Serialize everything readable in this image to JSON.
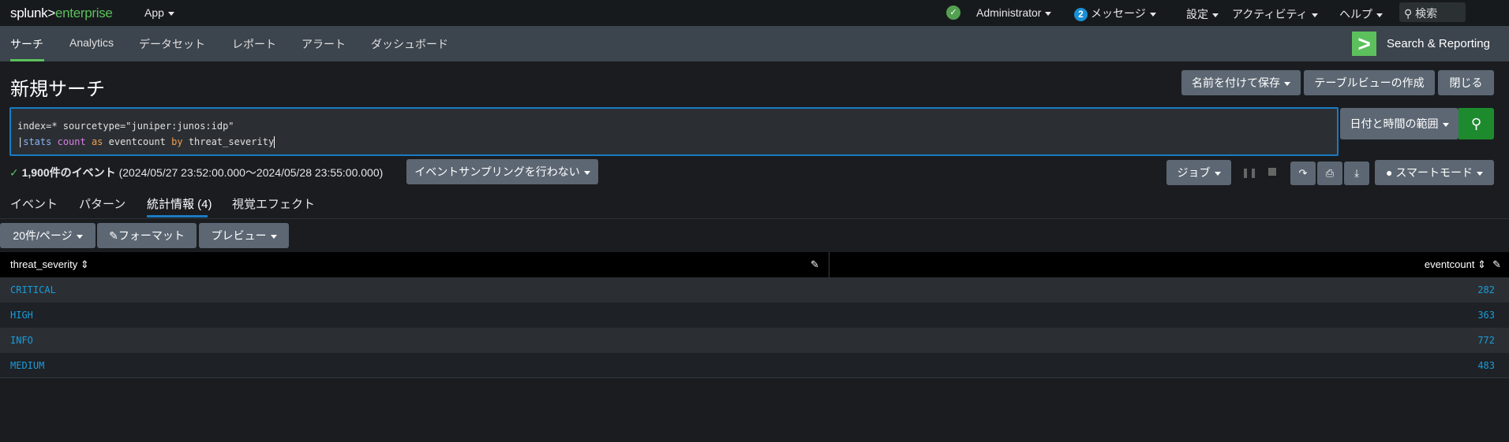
{
  "topbar": {
    "logo_main": "splunk>",
    "logo_sub": "enterprise",
    "app_menu": "App",
    "user": "Administrator",
    "message_count": "2",
    "messages": "メッセージ",
    "settings": "設定",
    "activity": "アクティビティ",
    "help": "ヘルプ",
    "search_placeholder": "検索"
  },
  "appnav": {
    "items": [
      "サーチ",
      "Analytics",
      "データセット",
      "レポート",
      "アラート",
      "ダッシュボード"
    ],
    "app_title": "Search & Reporting"
  },
  "page": {
    "title": "新規サーチ",
    "save_as": "名前を付けて保存",
    "create_table_view": "テーブルビューの作成",
    "close": "閉じる"
  },
  "search": {
    "line1": "index=* sourcetype=\"juniper:junos:idp\"",
    "pipe": "|",
    "cmd": "stats",
    "func": "count",
    "as": "as",
    "field": "eventcount",
    "by": "by",
    "group": "threat_severity",
    "time_range": "日付と時間の範囲"
  },
  "status": {
    "count": "1,900件のイベント",
    "range": "(2024/05/27 23:52:00.000〜2024/05/28 23:55:00.000)",
    "sampling": "イベントサンプリングを行わない",
    "job": "ジョブ",
    "mode": "スマートモード"
  },
  "tabs": [
    "イベント",
    "パターン",
    "統計情報 (4)",
    "視覚エフェクト"
  ],
  "toolbar": {
    "per_page": "20件/ページ",
    "format": "フォーマット",
    "preview": "プレビュー"
  },
  "table": {
    "columns": [
      "threat_severity",
      "eventcount"
    ],
    "rows": [
      [
        "CRITICAL",
        "282"
      ],
      [
        "HIGH",
        "363"
      ],
      [
        "INFO",
        "772"
      ],
      [
        "MEDIUM",
        "483"
      ]
    ]
  },
  "colors": {
    "accent": "#5cc05c",
    "link": "#1a9cdb",
    "focus": "#1a7bc2",
    "search_button": "#1e8a2e"
  }
}
